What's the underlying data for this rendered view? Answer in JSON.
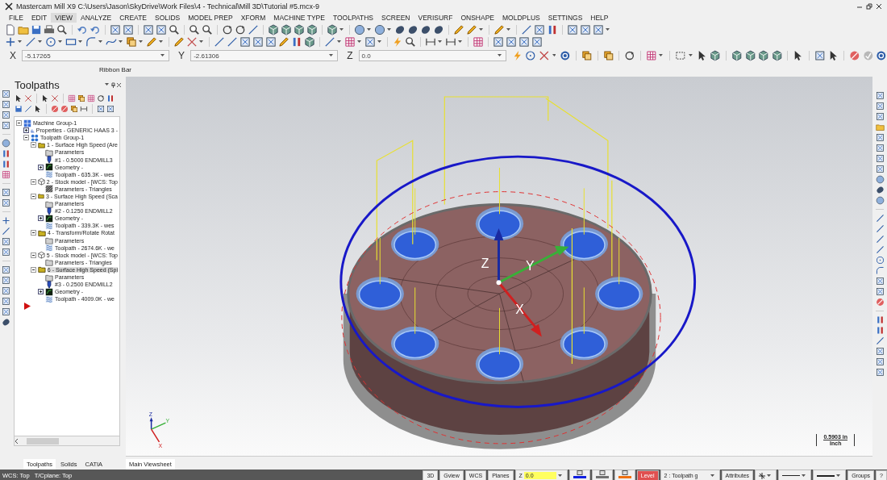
{
  "window": {
    "title": "Mastercam Mill X9  C:\\Users\\Jason\\SkyDrive\\Work Files\\4 - Technical\\Mill 3D\\Tutorial #5.mcx-9"
  },
  "menu": [
    {
      "label": "FILE",
      "selected": false
    },
    {
      "label": "EDIT",
      "selected": false
    },
    {
      "label": "VIEW",
      "selected": true
    },
    {
      "label": "ANALYZE",
      "selected": false
    },
    {
      "label": "CREATE",
      "selected": false
    },
    {
      "label": "SOLIDS",
      "selected": false
    },
    {
      "label": "MODEL PREP",
      "selected": false
    },
    {
      "label": "XFORM",
      "selected": false
    },
    {
      "label": "MACHINE TYPE",
      "selected": false
    },
    {
      "label": "TOOLPATHS",
      "selected": false
    },
    {
      "label": "SCREEN",
      "selected": false
    },
    {
      "label": "VERISURF",
      "selected": false
    },
    {
      "label": "ONSHAPE",
      "selected": false
    },
    {
      "label": "MOLDPLUS",
      "selected": false
    },
    {
      "label": "SETTINGS",
      "selected": false
    },
    {
      "label": "HELP",
      "selected": false
    }
  ],
  "coordinates": [
    {
      "axis": "X",
      "value": "-5.17265"
    },
    {
      "axis": "Y",
      "value": "-2.61306"
    },
    {
      "axis": "Z",
      "value": "0.0"
    }
  ],
  "ribbon_label": "Ribbon Bar",
  "panel": {
    "title": "Toolpaths",
    "tree": [
      {
        "label": "Machine Group-1",
        "kind": "machine",
        "expanded": true,
        "selected": false,
        "children": [
          {
            "label": "Properties - GENERIC HAAS 3 -",
            "kind": "properties",
            "expanded": false,
            "selected": false
          },
          {
            "label": "Toolpath Group-1",
            "kind": "group",
            "expanded": true,
            "selected": false,
            "children": [
              {
                "label": "1 - Surface High Speed (Are",
                "kind": "operation",
                "expanded": true,
                "selected": false,
                "children": [
                  {
                    "label": "Parameters",
                    "kind": "parameters",
                    "selected": false
                  },
                  {
                    "label": "#1 - 0.5000 ENDMILL3",
                    "kind": "tool",
                    "selected": false
                  },
                  {
                    "label": "Geometry -",
                    "kind": "geometry",
                    "expanded": false,
                    "selected": false
                  },
                  {
                    "label": "Toolpath - 635.3K - wes",
                    "kind": "toolpath",
                    "selected": false
                  }
                ]
              },
              {
                "label": "2 - Stock model - [WCS: Top",
                "kind": "stock",
                "expanded": true,
                "selected": false,
                "children": [
                  {
                    "label": "Parameters - Triangles",
                    "kind": "triangles",
                    "selected": false
                  }
                ]
              },
              {
                "label": "3 - Surface High Speed (Sca",
                "kind": "operation",
                "expanded": true,
                "selected": false,
                "children": [
                  {
                    "label": "Parameters",
                    "kind": "parameters",
                    "selected": false
                  },
                  {
                    "label": "#2 - 0.1250 ENDMILL2",
                    "kind": "tool",
                    "selected": false
                  },
                  {
                    "label": "Geometry -",
                    "kind": "geometry",
                    "expanded": false,
                    "selected": false
                  },
                  {
                    "label": "Toolpath - 339.3K - wes",
                    "kind": "toolpath",
                    "selected": false
                  }
                ]
              },
              {
                "label": "4 - Transform/Rotate Rotat",
                "kind": "operation",
                "expanded": true,
                "selected": false,
                "children": [
                  {
                    "label": "Parameters",
                    "kind": "parameters",
                    "selected": false
                  },
                  {
                    "label": "Toolpath - 2674.6K - we",
                    "kind": "toolpath",
                    "selected": false
                  }
                ]
              },
              {
                "label": "5 - Stock model - [WCS: Top",
                "kind": "stock",
                "expanded": true,
                "selected": false,
                "children": [
                  {
                    "label": "Parameters - Triangles",
                    "kind": "parameters",
                    "selected": false
                  }
                ]
              },
              {
                "label": "6 - Surface High Speed (Spi",
                "kind": "operation",
                "expanded": true,
                "selected": true,
                "children": [
                  {
                    "label": "Parameters",
                    "kind": "parameters",
                    "selected": false
                  },
                  {
                    "label": "#3 - 0.2500 ENDMILL2",
                    "kind": "tool",
                    "selected": false
                  },
                  {
                    "label": "Geometry -",
                    "kind": "geometry",
                    "expanded": false,
                    "selected": false
                  },
                  {
                    "label": "Toolpath - 4009.0K - we",
                    "kind": "toolpath",
                    "selected": false
                  }
                ]
              }
            ]
          }
        ]
      }
    ]
  },
  "panel_tabs": [
    {
      "label": "Toolpaths",
      "selected": true
    },
    {
      "label": "Solids",
      "selected": false
    },
    {
      "label": "CATIA",
      "selected": false
    }
  ],
  "viewport": {
    "tab": "Main Viewsheet",
    "axis_labels": [
      "Z",
      "Y",
      "X"
    ],
    "triad_labels": [
      "Z",
      "Y",
      "X"
    ],
    "scale": {
      "value": "0.5903 in",
      "unit": "Inch"
    }
  },
  "status_bar": {
    "wcs": "WCS: Top",
    "cplane": "T/Cplane: Top",
    "view_buttons": [
      "3D",
      "Gview",
      "WCS",
      "Planes"
    ],
    "z_label": "Z",
    "z_value": "0.0",
    "level_label": "Level",
    "level_value": "2 : Toolpath g",
    "attributes": "Attributes",
    "groups": "Groups",
    "help": "?"
  }
}
